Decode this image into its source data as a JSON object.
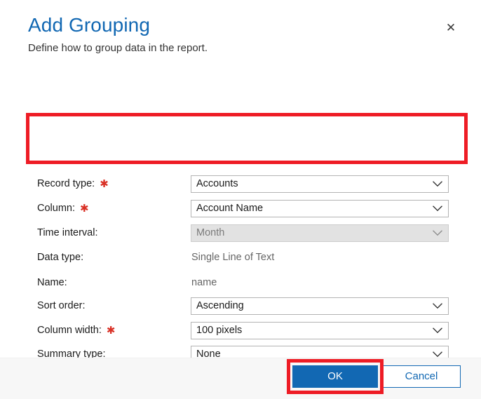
{
  "dialog": {
    "title": "Add Grouping",
    "subtitle": "Define how to group data in the report.",
    "close_label": "✕",
    "close_icon": "close-icon"
  },
  "form": {
    "rows": [
      {
        "label": "Record type:",
        "required": true,
        "star": "✱",
        "control": "combobox",
        "value": "Accounts",
        "disabled": false,
        "name": "record-type"
      },
      {
        "label": "Column:",
        "required": true,
        "star": "✱",
        "control": "combobox",
        "value": "Account Name",
        "disabled": false,
        "name": "column"
      },
      {
        "label": "Time interval:",
        "required": false,
        "star": "",
        "control": "combobox",
        "value": "Month",
        "disabled": true,
        "name": "time-interval"
      },
      {
        "label": "Data type:",
        "required": false,
        "star": "",
        "control": "readonly",
        "value": "Single Line of Text",
        "disabled": true,
        "name": "data-type"
      },
      {
        "label": "Name:",
        "required": false,
        "star": "",
        "control": "readonly",
        "value": "name",
        "disabled": true,
        "name": "name"
      },
      {
        "label": "Sort order:",
        "required": false,
        "star": "",
        "control": "combobox",
        "value": "Ascending",
        "disabled": false,
        "name": "sort-order"
      },
      {
        "label": "Column width:",
        "required": true,
        "star": "✱",
        "control": "combobox",
        "value": "100 pixels",
        "disabled": false,
        "name": "column-width"
      },
      {
        "label": "Summary type:",
        "required": false,
        "star": "",
        "control": "combobox",
        "value": "None",
        "disabled": false,
        "name": "summary-type"
      }
    ]
  },
  "footer": {
    "ok_label": "OK",
    "cancel_label": "Cancel"
  },
  "annotations": [
    {
      "name": "highlight-required-fields"
    },
    {
      "name": "highlight-ok-button"
    }
  ],
  "colors": {
    "accent_blue": "#1268b3",
    "annotation_red": "#ee1c25",
    "required_star_red": "#d93025",
    "disabled_fill": "#e2e2e2",
    "footer_bg": "#f7f7f7",
    "readonly_text": "#666666"
  }
}
